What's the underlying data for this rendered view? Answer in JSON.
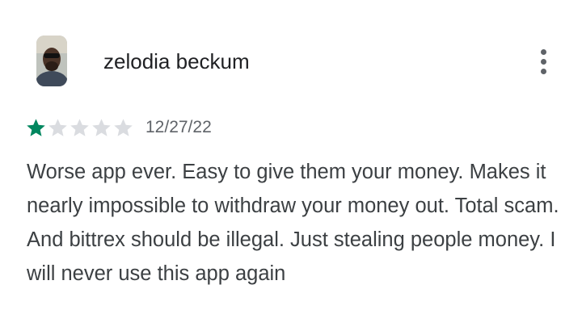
{
  "review": {
    "author_name": "zelodia beckum",
    "avatar_icon": "user-photo",
    "more_icon": "more-vert-icon",
    "rating": 1,
    "rating_max": 5,
    "date": "12/27/22",
    "text": "Worse app ever. Easy to give them your money. Makes it nearly impossible to withdraw your money out. Total scam. And bittrex should be illegal. Just stealing people money. I will never use this app again",
    "colors": {
      "star_filled": "#01875f",
      "star_empty": "#dadce0"
    }
  }
}
